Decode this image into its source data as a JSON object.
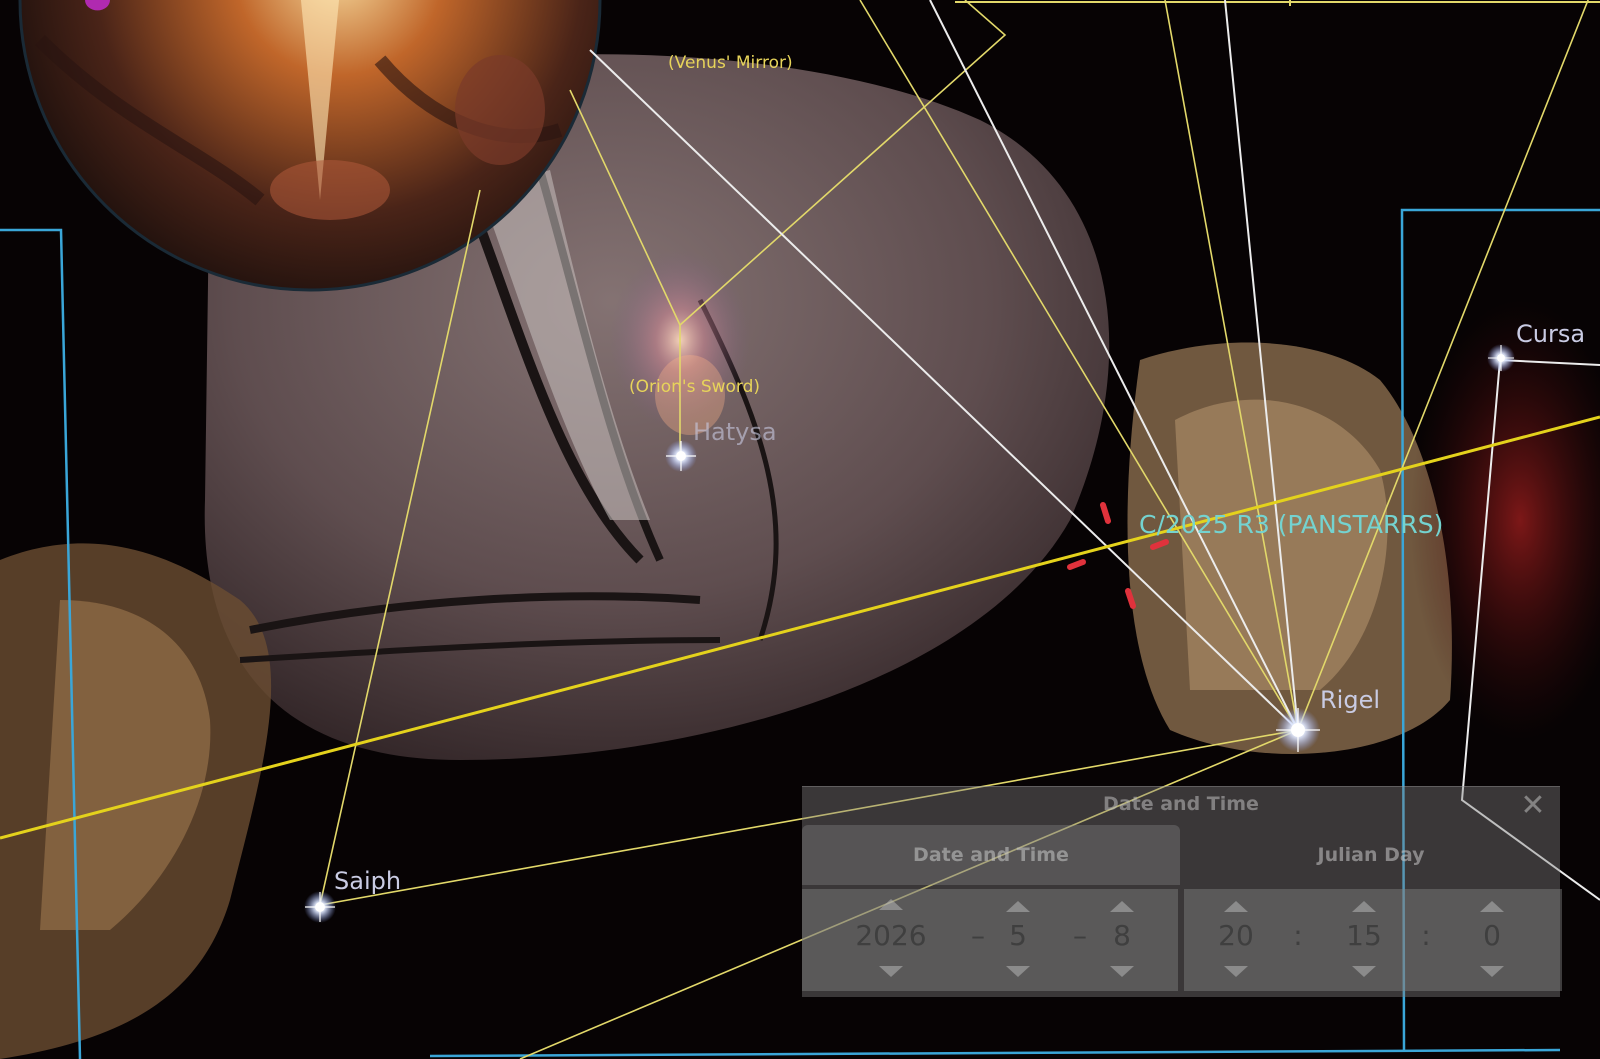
{
  "labels": {
    "venus_mirror": "(Venus' Mirror)",
    "orions_sword": "(Orion's Sword)",
    "hatysa": "Hatysa",
    "comet": "C/2025 R3 (PANSTARRS)",
    "cursa": "Cursa",
    "rigel": "Rigel",
    "saiph": "Saiph"
  },
  "dialog": {
    "title": "Date and Time",
    "close": "✕",
    "tabs": {
      "datetime": "Date and Time",
      "julian": "Julian Day"
    },
    "date": {
      "year": "2026",
      "month": "5",
      "day": "8",
      "separator": "–"
    },
    "time": {
      "hour": "20",
      "minute": "15",
      "second": "0",
      "separator": ":"
    }
  },
  "colors": {
    "boundary": "#3aa6d8",
    "asterism": "#e2d86a",
    "constellation": "#e8e8e8",
    "ecliptic": "#e4d21c",
    "target_marker": "#e0323c",
    "comet_label": "#74d3d0",
    "star_label": "#c9cbe3"
  },
  "icons": {
    "close": "close-icon",
    "spin_up": "chevron-up-icon",
    "spin_down": "chevron-down-icon",
    "star": "star-icon"
  }
}
